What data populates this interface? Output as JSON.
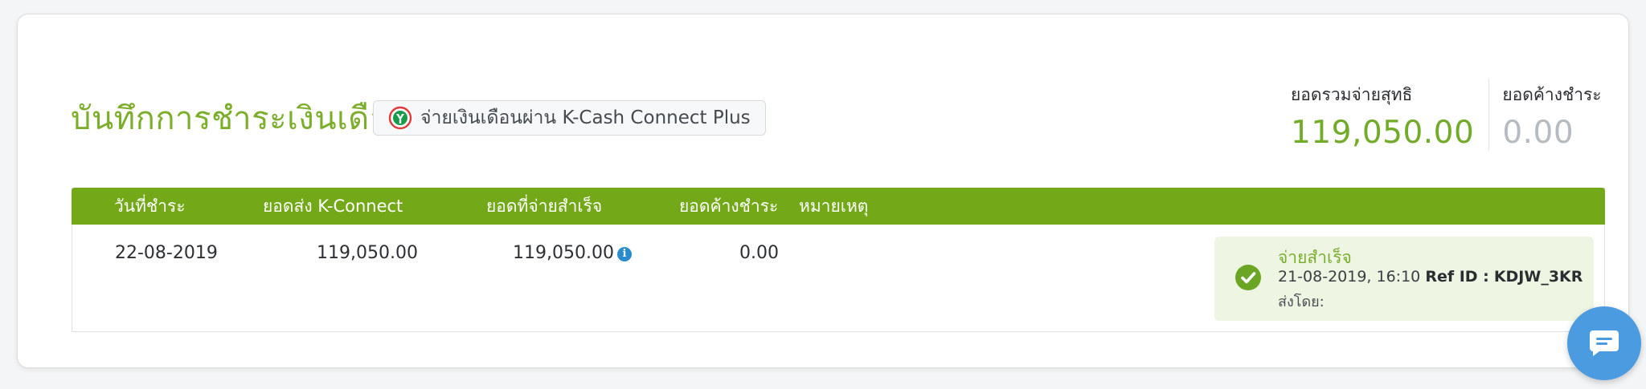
{
  "header": {
    "title": "บันทึกการชำระเงินเดือน",
    "kcash_button_label": "จ่ายเงินเดือนผ่าน K-Cash Connect Plus"
  },
  "summary": {
    "net_total_label": "ยอดรวมจ่ายสุทธิ",
    "net_total_value": "119,050.00",
    "outstanding_label": "ยอดค้างชำระ",
    "outstanding_value": "0.00"
  },
  "table": {
    "columns": [
      "วันที่ชำระ",
      "ยอดส่ง K-Connect",
      "ยอดที่จ่ายสำเร็จ",
      "ยอดค้างชำระ",
      "หมายเหตุ"
    ],
    "rows": [
      {
        "date": "22-08-2019",
        "kconnect_amount": "119,050.00",
        "paid_amount": "119,050.00",
        "outstanding": "0.00",
        "status": {
          "title": "จ่ายสำเร็จ",
          "datetime": "21-08-2019, 16:10",
          "ref_label": "Ref ID :",
          "ref_value": "KDJW_3KR",
          "sender_label": "ส่งโดย:"
        }
      }
    ]
  },
  "colors": {
    "brand_green": "#73a818",
    "title_green": "#7cae2c",
    "chat_blue": "#4b9be0"
  },
  "icons": {
    "kbank": "kbank-logo-icon",
    "info": "info-icon",
    "check": "check-circle-icon",
    "chat": "chat-icon"
  }
}
